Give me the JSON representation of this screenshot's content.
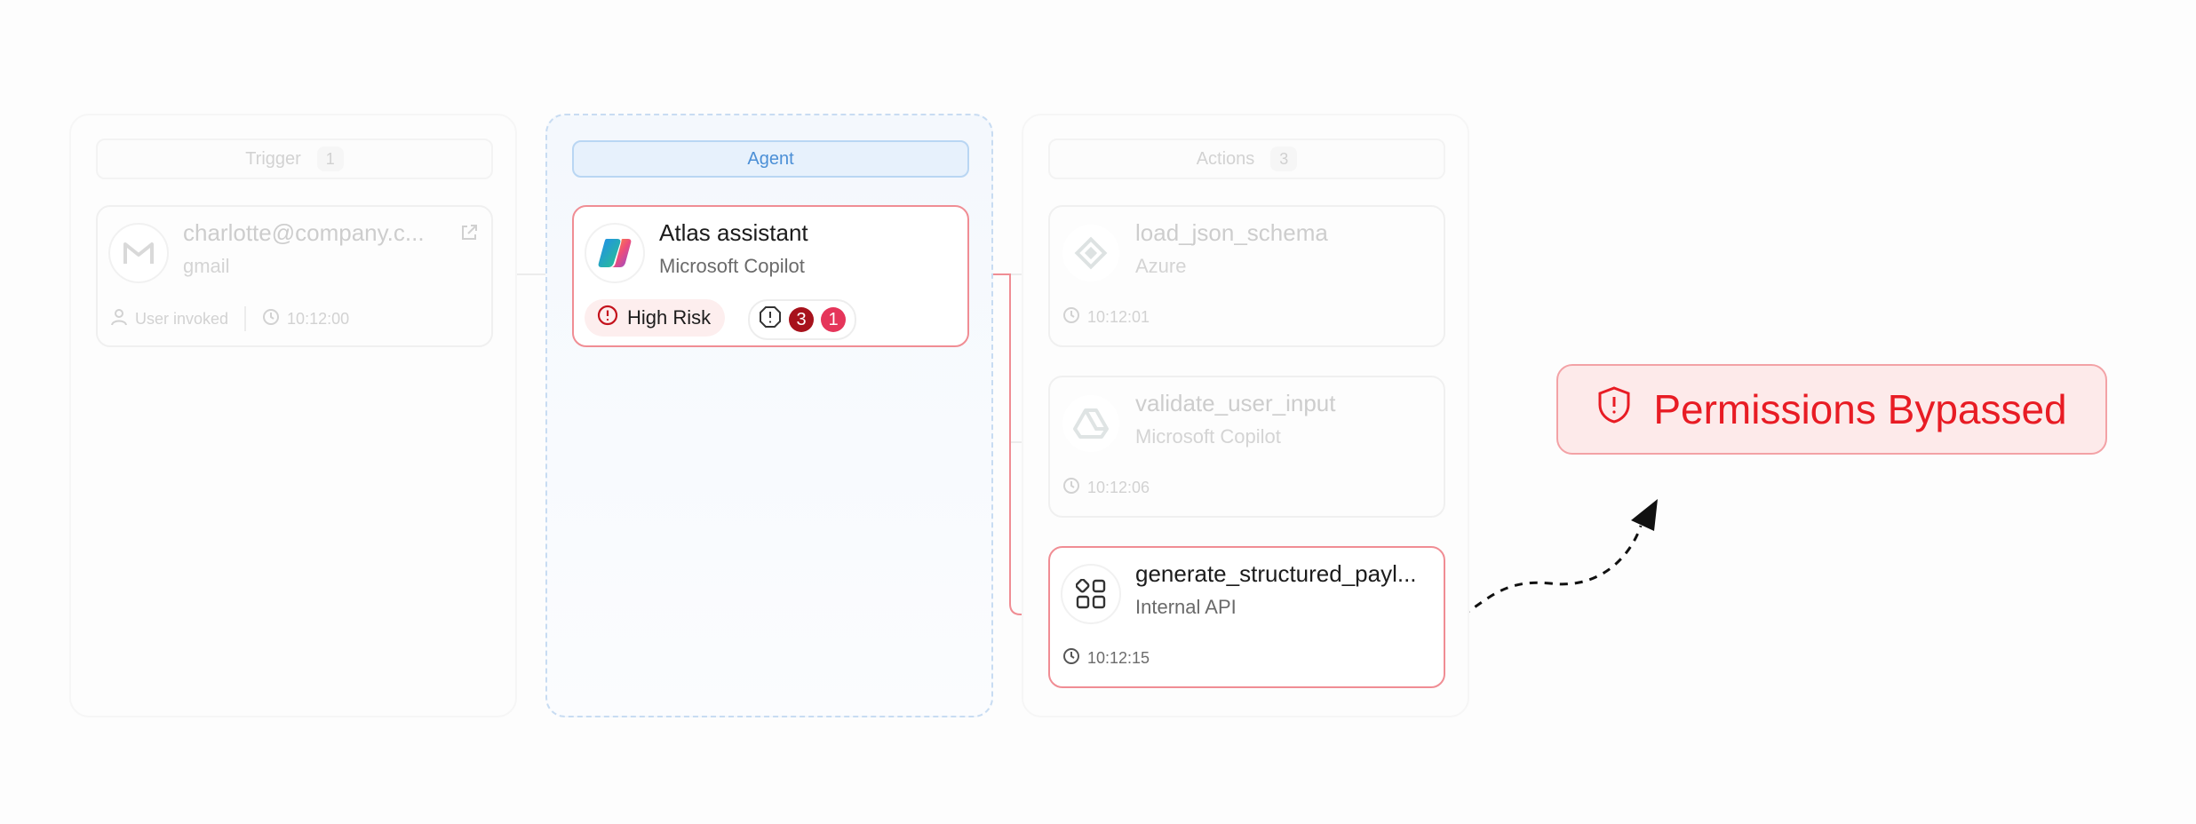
{
  "columns": {
    "trigger": {
      "label": "Trigger",
      "count": "1"
    },
    "agent": {
      "label": "Agent"
    },
    "actions": {
      "label": "Actions",
      "count": "3"
    }
  },
  "trigger_card": {
    "title": "charlotte@company.c...",
    "subtitle": "gmail",
    "invoked": "User invoked",
    "time": "10:12:00",
    "icon": "gmail-icon"
  },
  "agent_card": {
    "title": "Atlas assistant",
    "subtitle": "Microsoft Copilot",
    "risk_label": "High Risk",
    "alert_count_high": "3",
    "alert_count_medium": "1",
    "icon": "copilot-icon"
  },
  "action_cards": [
    {
      "title": "load_json_schema",
      "subtitle": "Azure",
      "time": "10:12:01",
      "icon": "azure-icon"
    },
    {
      "title": "validate_user_input",
      "subtitle": "Microsoft Copilot",
      "time": "10:12:06",
      "icon": "drive-icon"
    },
    {
      "title": "generate_structured_payl...",
      "subtitle": "Internal API",
      "time": "10:12:15",
      "icon": "apps-grid-icon"
    }
  ],
  "callout": {
    "label": "Permissions Bypassed",
    "icon": "shield-alert-icon"
  },
  "colors": {
    "risk_red": "#e81c24",
    "highlight_border": "#f08d94",
    "agent_blue": "#4b8fd6",
    "badge_dark_red": "#a7121c",
    "badge_pink": "#e5355a"
  }
}
